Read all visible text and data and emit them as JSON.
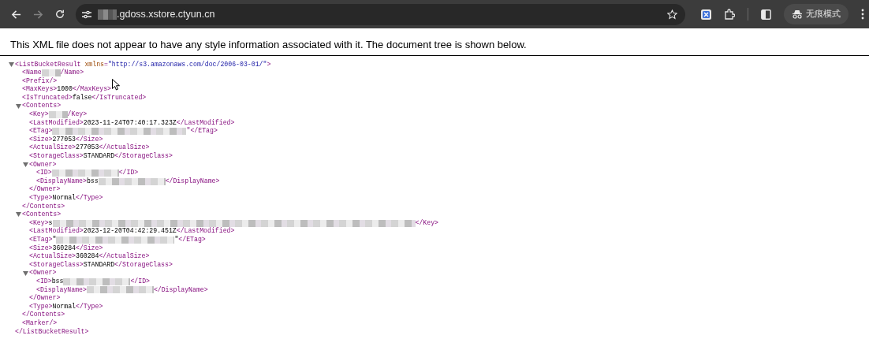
{
  "browser": {
    "back": {
      "disabled": false
    },
    "forward": {
      "disabled": true
    },
    "url": [
      {
        "kind": "redactedshort"
      },
      {
        "kind": "text",
        "text": ".gdoss.xstore.ctyun.cn"
      }
    ],
    "profile_label": "无痕模式"
  },
  "notice": "This XML file does not appear to have any style information associated with it. The document tree is shown below.",
  "tree": {
    "open": [
      {
        "kind": "tag",
        "text": "<ListBucketResult"
      },
      {
        "kind": "attr",
        "text": "xmlns"
      },
      {
        "kind": "tag",
        "text": "="
      },
      {
        "kind": "value",
        "text": "\"http://s3.amazonaws.com/doc/2006-03-01/\""
      },
      {
        "kind": "tag",
        "text": ">"
      }
    ],
    "expanded": true,
    "children": [
      {
        "line": [
          {
            "kind": "tag",
            "text": "<Name"
          },
          {
            "kind": "redactedshort"
          },
          {
            "kind": "tag",
            "text": "/Name>"
          }
        ]
      },
      {
        "line": [
          {
            "kind": "tag",
            "text": "<Prefix/>"
          }
        ]
      },
      {
        "line": [
          {
            "kind": "tag",
            "text": "<MaxKeys>"
          },
          {
            "kind": "text",
            "text": "1000"
          },
          {
            "kind": "tag",
            "text": "</MaxKeys>"
          }
        ]
      },
      {
        "line": [
          {
            "kind": "tag",
            "text": "<IsTruncated>"
          },
          {
            "kind": "text",
            "text": "false"
          },
          {
            "kind": "tag",
            "text": "</IsTruncated>"
          }
        ]
      },
      {
        "open": [
          {
            "kind": "tag",
            "text": "<Contents>"
          }
        ],
        "expanded": true,
        "children": [
          {
            "line": [
              {
                "kind": "tag",
                "text": "<Key>"
              },
              {
                "kind": "redactedshort"
              },
              {
                "kind": "tag",
                "text": "/Key>"
              }
            ]
          },
          {
            "line": [
              {
                "kind": "tag",
                "text": "<LastModified>"
              },
              {
                "kind": "text",
                "text": "2023-11-24T07:40:17.323Z"
              },
              {
                "kind": "tag",
                "text": "</LastModified>"
              }
            ]
          },
          {
            "line": [
              {
                "kind": "tag",
                "text": "<ETag>"
              },
              {
                "kind": "redactedwide"
              },
              {
                "kind": "tag",
                "text": "\"</ETag>"
              }
            ]
          },
          {
            "line": [
              {
                "kind": "tag",
                "text": "<Size>"
              },
              {
                "kind": "text",
                "text": "277053"
              },
              {
                "kind": "tag",
                "text": "</Size>"
              }
            ]
          },
          {
            "line": [
              {
                "kind": "tag",
                "text": "<ActualSize>"
              },
              {
                "kind": "text",
                "text": "277053"
              },
              {
                "kind": "tag",
                "text": "</ActualSize>"
              }
            ]
          },
          {
            "line": [
              {
                "kind": "tag",
                "text": "<StorageClass>"
              },
              {
                "kind": "text",
                "text": "STANDARD"
              },
              {
                "kind": "tag",
                "text": "</StorageClass>"
              }
            ]
          },
          {
            "open": [
              {
                "kind": "tag",
                "text": "<Owner>"
              }
            ],
            "expanded": true,
            "children": [
              {
                "line": [
                  {
                    "kind": "tag",
                    "text": "<ID>"
                  },
                  {
                    "kind": "redactedmedium"
                  },
                  {
                    "kind": "tag",
                    "text": "</ID>"
                  }
                ]
              },
              {
                "line": [
                  {
                    "kind": "tag",
                    "text": "<DisplayName>"
                  },
                  {
                    "kind": "text",
                    "text": "bss"
                  },
                  {
                    "kind": "redactedmedium"
                  },
                  {
                    "kind": "tag",
                    "text": "</DisplayName>"
                  }
                ]
              }
            ],
            "close": [
              {
                "kind": "tag",
                "text": "</Owner>"
              }
            ]
          },
          {
            "line": [
              {
                "kind": "tag",
                "text": "<Type>"
              },
              {
                "kind": "text",
                "text": "Normal"
              },
              {
                "kind": "tag",
                "text": "</Type>"
              }
            ]
          }
        ],
        "close": [
          {
            "kind": "tag",
            "text": "</Contents>"
          }
        ]
      },
      {
        "open": [
          {
            "kind": "tag",
            "text": "<Contents>"
          }
        ],
        "expanded": true,
        "children": [
          {
            "line": [
              {
                "kind": "tag",
                "text": "<Key>"
              },
              {
                "kind": "text",
                "text": "s"
              },
              {
                "kind": "redactedfull"
              },
              {
                "kind": "tag",
                "text": "</Key>"
              }
            ]
          },
          {
            "line": [
              {
                "kind": "tag",
                "text": "<LastModified>"
              },
              {
                "kind": "text",
                "text": "2023-12-20T04:42:29.451Z"
              },
              {
                "kind": "tag",
                "text": "</LastModified>"
              }
            ]
          },
          {
            "line": [
              {
                "kind": "tag",
                "text": "<ETag>"
              },
              {
                "kind": "text",
                "text": "\""
              },
              {
                "kind": "redactedlong"
              },
              {
                "kind": "text",
                "text": "\""
              },
              {
                "kind": "tag",
                "text": "</ETag>"
              }
            ]
          },
          {
            "line": [
              {
                "kind": "tag",
                "text": "<Size>"
              },
              {
                "kind": "text",
                "text": "360284"
              },
              {
                "kind": "tag",
                "text": "</Size>"
              }
            ]
          },
          {
            "line": [
              {
                "kind": "tag",
                "text": "<ActualSize>"
              },
              {
                "kind": "text",
                "text": "360284"
              },
              {
                "kind": "tag",
                "text": "</ActualSize>"
              }
            ]
          },
          {
            "line": [
              {
                "kind": "tag",
                "text": "<StorageClass>"
              },
              {
                "kind": "text",
                "text": "STANDARD"
              },
              {
                "kind": "tag",
                "text": "</StorageClass>"
              }
            ]
          },
          {
            "open": [
              {
                "kind": "tag",
                "text": "<Owner>"
              }
            ],
            "expanded": true,
            "children": [
              {
                "line": [
                  {
                    "kind": "tag",
                    "text": "<ID>"
                  },
                  {
                    "kind": "text",
                    "text": "bss"
                  },
                  {
                    "kind": "redactedmedium"
                  },
                  {
                    "kind": "tag",
                    "text": "</ID>"
                  }
                ]
              },
              {
                "line": [
                  {
                    "kind": "tag",
                    "text": "<DisplayName>"
                  },
                  {
                    "kind": "redactedmedium"
                  },
                  {
                    "kind": "tag",
                    "text": "</DisplayName>"
                  }
                ]
              }
            ],
            "close": [
              {
                "kind": "tag",
                "text": "</Owner>"
              }
            ]
          },
          {
            "line": [
              {
                "kind": "tag",
                "text": "<Type>"
              },
              {
                "kind": "text",
                "text": "Normal"
              },
              {
                "kind": "tag",
                "text": "</Type>"
              }
            ]
          }
        ],
        "close": [
          {
            "kind": "tag",
            "text": "</Contents>"
          }
        ]
      },
      {
        "line": [
          {
            "kind": "tag",
            "text": "<Marker/>"
          }
        ]
      }
    ],
    "close": [
      {
        "kind": "tag",
        "text": "</ListBucketResult>"
      }
    ]
  }
}
